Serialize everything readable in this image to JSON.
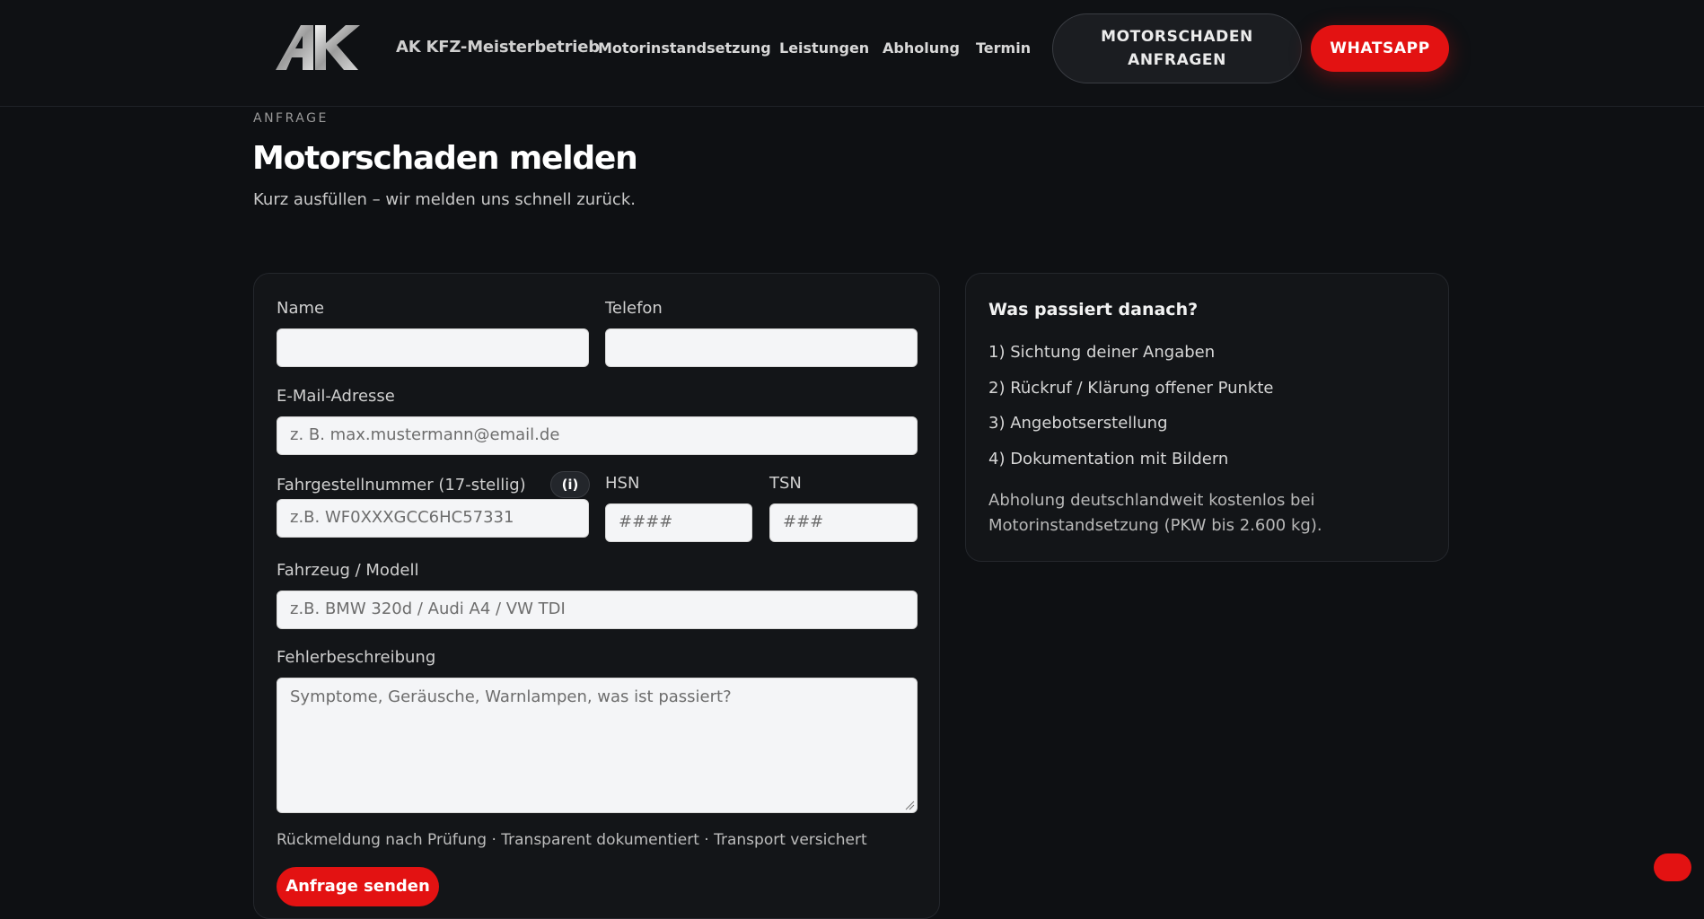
{
  "header": {
    "brand": "AK KFZ-Meisterbetrieb",
    "nav": [
      "Motorinstandsetzung",
      "Leistungen",
      "Abholung",
      "Termin"
    ],
    "cta_line1": "MOTORSCHADEN",
    "cta_line2": "ANFRAGEN",
    "whatsapp": "WHATSAPP"
  },
  "hero": {
    "eyebrow": "ANFRAGE",
    "title": "Motorschaden melden",
    "subtitle": "Kurz ausfüllen – wir melden uns schnell zurück."
  },
  "form": {
    "name_label": "Name",
    "name_value": "",
    "phone_label": "Telefon",
    "phone_value": "",
    "email_label": "E-Mail-Adresse",
    "email_placeholder": "z. B. max.mustermann@email.de",
    "vin_label": "Fahrgestellnummer (17-stellig)",
    "vin_info": "(i)",
    "vin_placeholder": "z.B. WF0XXXGCC6HC57331",
    "hsn_label": "HSN",
    "hsn_placeholder": "####",
    "tsn_label": "TSN",
    "tsn_placeholder": "###",
    "model_label": "Fahrzeug / Modell",
    "model_placeholder": "z.B. BMW 320d / Audi A4 / VW TDI",
    "desc_label": "Fehlerbeschreibung",
    "desc_placeholder": "Symptome, Geräusche, Warnlampen, was ist passiert?",
    "trust": "Rückmeldung nach Prüfung · Transparent dokumentiert · Transport versichert",
    "submit": "Anfrage senden"
  },
  "info": {
    "title": "Was passiert danach?",
    "steps": [
      "1) Sichtung deiner Angaben",
      "2) Rückruf / Klärung offener Punkte",
      "3) Angebotserstellung",
      "4) Dokumentation mit Bildern"
    ],
    "note": "Abholung deutschlandweit kostenlos bei Motorinstandsetzung (PKW bis 2.600 kg)."
  },
  "colors": {
    "background": "#0e1013",
    "accent": "#e31212",
    "card": "#131518"
  },
  "icons": {
    "logo": "ak-logo-icon",
    "chat": "chat-bubble-icon"
  }
}
